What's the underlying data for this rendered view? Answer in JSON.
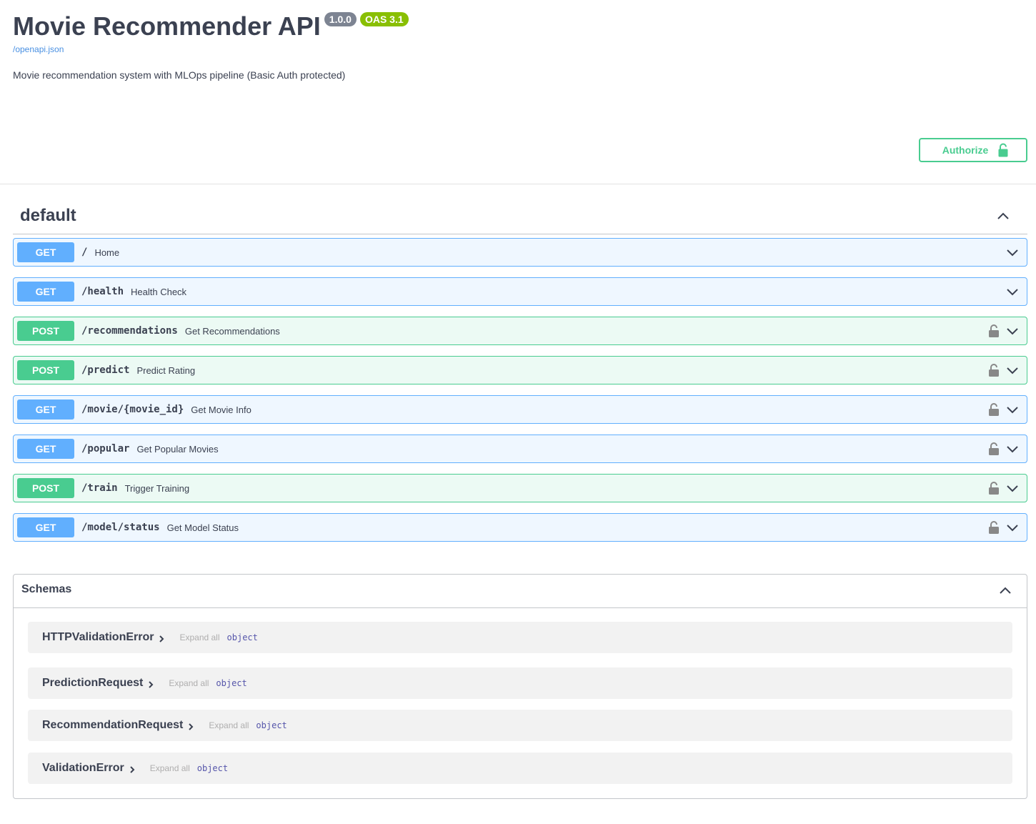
{
  "info": {
    "title": "Movie Recommender API",
    "version": "1.0.0",
    "oas_version": "OAS 3.1",
    "spec_link": "/openapi.json",
    "description": "Movie recommendation system with MLOps pipeline (Basic Auth protected)"
  },
  "authorize": {
    "label": "Authorize"
  },
  "tag": {
    "name": "default"
  },
  "operations": [
    {
      "method": "GET",
      "path": "/",
      "summary": "Home",
      "locked": false
    },
    {
      "method": "GET",
      "path": "/health",
      "summary": "Health Check",
      "locked": false
    },
    {
      "method": "POST",
      "path": "/recommendations",
      "summary": "Get Recommendations",
      "locked": true
    },
    {
      "method": "POST",
      "path": "/predict",
      "summary": "Predict Rating",
      "locked": true
    },
    {
      "method": "GET",
      "path": "/movie/{movie_id}",
      "summary": "Get Movie Info",
      "locked": true
    },
    {
      "method": "GET",
      "path": "/popular",
      "summary": "Get Popular Movies",
      "locked": true
    },
    {
      "method": "POST",
      "path": "/train",
      "summary": "Trigger Training",
      "locked": true
    },
    {
      "method": "GET",
      "path": "/model/status",
      "summary": "Get Model Status",
      "locked": true
    }
  ],
  "schemas": {
    "title": "Schemas",
    "items": [
      {
        "name": "HTTPValidationError",
        "expand_label": "Expand all",
        "type": "object"
      },
      {
        "name": "PredictionRequest",
        "expand_label": "Expand all",
        "type": "object"
      },
      {
        "name": "RecommendationRequest",
        "expand_label": "Expand all",
        "type": "object"
      },
      {
        "name": "ValidationError",
        "expand_label": "Expand all",
        "type": "object"
      }
    ]
  },
  "colors": {
    "get": "#61affe",
    "post": "#49cc90",
    "version_badge": "#7d8492",
    "oas_badge": "#89bf04",
    "link": "#4990e2"
  },
  "icons": {
    "authorize": "unlocked-padlock-icon",
    "operation_lock": "padlock-icon",
    "expand": "chevron-down-icon",
    "collapse": "chevron-up-icon",
    "model_expand": "chevron-right-icon"
  }
}
